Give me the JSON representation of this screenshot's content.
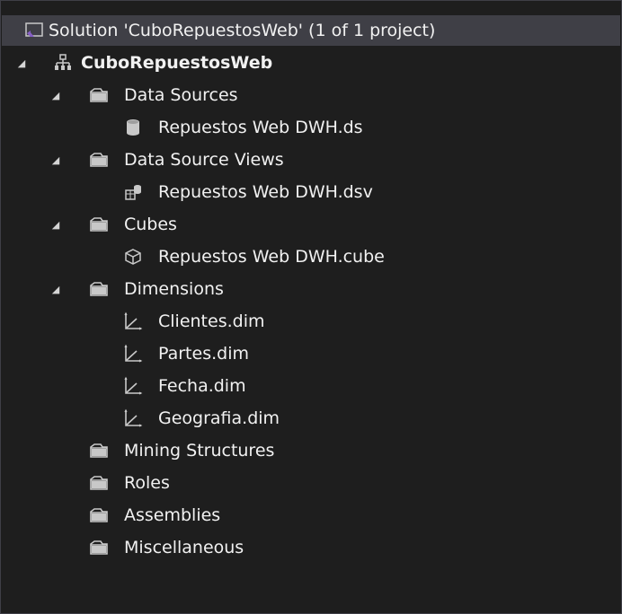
{
  "solution": {
    "label": "Solution 'CuboRepuestosWeb' (1 of 1 project)",
    "icon": "solution-icon"
  },
  "project": {
    "label": "CuboRepuestosWeb",
    "icon": "project-icon",
    "expanded": true
  },
  "folders": {
    "data_sources": {
      "label": "Data Sources",
      "expanded": true,
      "items": [
        {
          "label": "Repuestos Web DWH.ds",
          "icon": "database-icon"
        }
      ]
    },
    "data_source_views": {
      "label": "Data Source Views",
      "expanded": true,
      "items": [
        {
          "label": "Repuestos Web DWH.dsv",
          "icon": "data-source-view-icon"
        }
      ]
    },
    "cubes": {
      "label": "Cubes",
      "expanded": true,
      "items": [
        {
          "label": "Repuestos Web DWH.cube",
          "icon": "cube-icon"
        }
      ]
    },
    "dimensions": {
      "label": "Dimensions",
      "expanded": true,
      "items": [
        {
          "label": "Clientes.dim",
          "icon": "dimension-icon"
        },
        {
          "label": "Partes.dim",
          "icon": "dimension-icon"
        },
        {
          "label": "Fecha.dim",
          "icon": "dimension-icon"
        },
        {
          "label": "Geografia.dim",
          "icon": "dimension-icon"
        }
      ]
    },
    "mining_structures": {
      "label": "Mining Structures"
    },
    "roles": {
      "label": "Roles"
    },
    "assemblies": {
      "label": "Assemblies"
    },
    "miscellaneous": {
      "label": "Miscellaneous"
    }
  },
  "colors": {
    "background": "#1e1e1e",
    "selection": "#3f3f46",
    "text": "#f1f1f1",
    "vs_purple": "#865fc5"
  }
}
